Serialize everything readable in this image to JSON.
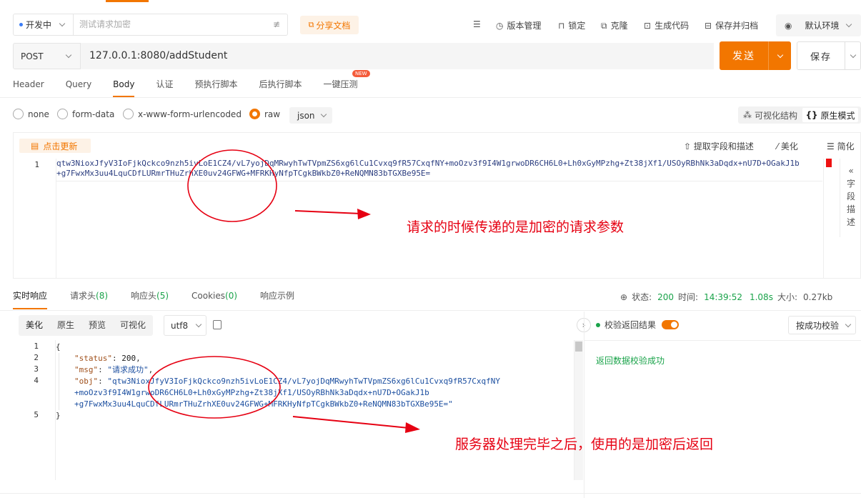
{
  "env_select": {
    "label": "开发中"
  },
  "request_name": {
    "placeholder": "测试请求加密"
  },
  "share": {
    "label": "分享文档"
  },
  "toolbar": {
    "version": "版本管理",
    "lock": "锁定",
    "clone": "克隆",
    "gen_code": "生成代码",
    "save_close": "保存并归档",
    "env": "默认环境"
  },
  "request": {
    "method": "POST",
    "url": "127.0.0.1:8080/addStudent",
    "send": "发送",
    "save": "保存"
  },
  "tabs": [
    "Header",
    "Query",
    "Body",
    "认证",
    "预执行脚本",
    "后执行脚本",
    "一键压测"
  ],
  "new_badge": "NEW",
  "body_types": [
    "none",
    "form-data",
    "x-www-form-urlencoded",
    "raw"
  ],
  "body_format": "json",
  "modes": {
    "visual": "可视化结构",
    "raw": "原生模式"
  },
  "editor_tools": {
    "refresh": "点击更新",
    "extract": "提取字段和描述",
    "beautify": "美化",
    "simplify": "简化"
  },
  "side_panel": {
    "label": [
      "字",
      "段",
      "描",
      "述"
    ]
  },
  "request_body": {
    "line_no": "1",
    "line1": "qtw3NioxJfyV3IoFjkQckco9nzh5ivLoE1CZ4/vL7yojDqMRwyhTwTVpmZS6xg6lCu1Cvxq9fR57CxqfNY+moOzv3f9I4W1grwoDR6CH6L0+Lh0xGyMPzhg+Zt38jXf1/USOyRBhNk3aDqdx+nU7D+OGakJ1b",
    "line2": "+g7FwxMx3uu4LquCDfLURmrTHuZrhXE0uv24GFWG+MFRKHyNfpTCgkBWkbZ0+ReNQMN83bTGXBe95E="
  },
  "annotation_request": "请求的时候传递的是加密的请求参数",
  "response_tabs": [
    {
      "label": "实时响应",
      "count": ""
    },
    {
      "label": "请求头",
      "count": "(8)"
    },
    {
      "label": "响应头",
      "count": "(5)"
    },
    {
      "label": "Cookies",
      "count": "(0)"
    },
    {
      "label": "响应示例",
      "count": ""
    }
  ],
  "status": {
    "status_label": "状态:",
    "status_value": "200",
    "time_label": "时间:",
    "time_value": "14:39:52",
    "duration": "1.08s",
    "size_label": "大小:",
    "size_value": "0.27kb"
  },
  "response_toolbar": {
    "beautify": "美化",
    "raw": "原生",
    "preview": "预览",
    "visual": "可视化",
    "encoding": "utf8"
  },
  "response": {
    "line_numbers": [
      "1",
      "2",
      "3",
      "4",
      "",
      "",
      "5"
    ],
    "open_brace": "{",
    "close_brace": "}",
    "status_key": "\"status\"",
    "status_value": "200",
    "msg_key": "\"msg\"",
    "msg_value": "\"请求成功\"",
    "obj_key": "\"obj\"",
    "obj_line1": "\"qtw3NioxJfyV3IoFjkQckco9nzh5ivLoE1CZ4/vL7yojDqMRwyhTwTVpmZS6xg6lCu1Cvxq9fR57CxqfNY",
    "obj_line2": "+moOzv3f9I4W1grwoDR6CH6L0+Lh0xGyMPzhg+Zt38jXf1/USOyRBhNk3aDqdx+nU7D+OGakJ1b",
    "obj_line3": "+g7FwxMx3uu4LquCDfLURmrTHuZrhXE0uv24GFWG+MFRKHyNfpTCgkBWkbZ0+ReNQMN83bTGXBe95E=\""
  },
  "validation": {
    "label": "校验返回结果",
    "mode": "按成功校验",
    "result": "返回数据校验成功"
  },
  "annotation_response": "服务器处理完毕之后，使用的是加密后返回",
  "colors": {
    "accent": "#f27600",
    "success": "#1aa34a",
    "annotation": "#e60012"
  }
}
